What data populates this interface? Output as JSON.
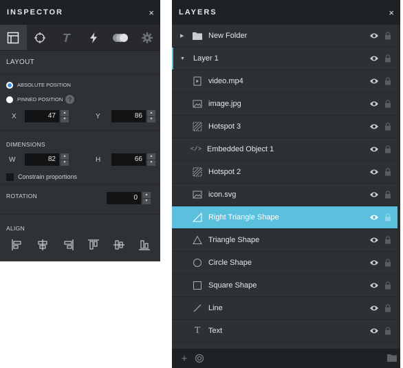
{
  "inspector": {
    "title": "INSPECTOR",
    "close": "×",
    "tabs": [
      {
        "icon": "layout-icon",
        "active": true
      },
      {
        "icon": "crosshair-icon",
        "active": false
      },
      {
        "icon": "text-icon",
        "active": false
      },
      {
        "icon": "lightning-icon",
        "active": false
      },
      {
        "icon": "blend-icon",
        "active": false
      },
      {
        "icon": "gear-icon",
        "active": false
      }
    ],
    "layout": {
      "title": "LAYOUT",
      "absolute_label": "ABSOLUTE POSITION",
      "pinned_label": "PINNED POSITION",
      "help": "?",
      "x_label": "X",
      "x_value": "47",
      "y_label": "Y",
      "y_value": "86"
    },
    "dimensions": {
      "title": "DIMENSIONS",
      "w_label": "W",
      "w_value": "82",
      "h_label": "H",
      "h_value": "66",
      "constrain_label": "Constrain proportions"
    },
    "rotation": {
      "title": "ROTATION",
      "value": "0"
    },
    "align": {
      "title": "ALIGN",
      "buttons": [
        "align-left-icon",
        "align-center-h-icon",
        "align-right-icon",
        "align-top-icon",
        "align-middle-v-icon",
        "align-bottom-icon"
      ]
    }
  },
  "layers": {
    "title": "LAYERS",
    "close": "×",
    "items": [
      {
        "name": "New Folder",
        "icon": "folder-icon",
        "kind": "folder"
      },
      {
        "name": "Layer 1",
        "icon": "",
        "kind": "group"
      },
      {
        "name": "video.mp4",
        "icon": "video-icon",
        "kind": "item"
      },
      {
        "name": "image.jpg",
        "icon": "image-icon",
        "kind": "item"
      },
      {
        "name": "Hotspot 3",
        "icon": "hotspot-icon",
        "kind": "item"
      },
      {
        "name": "Embedded Object 1",
        "icon": "code-icon",
        "kind": "item"
      },
      {
        "name": "Hotspot 2",
        "icon": "hotspot-icon",
        "kind": "item"
      },
      {
        "name": "icon.svg",
        "icon": "image-icon",
        "kind": "item"
      },
      {
        "name": "Right Triangle Shape",
        "icon": "right-triangle-icon",
        "kind": "item",
        "selected": true
      },
      {
        "name": "Triangle Shape",
        "icon": "triangle-icon",
        "kind": "item"
      },
      {
        "name": "Circle Shape",
        "icon": "circle-icon",
        "kind": "item"
      },
      {
        "name": "Square Shape",
        "icon": "square-icon",
        "kind": "item"
      },
      {
        "name": "Line",
        "icon": "line-icon",
        "kind": "item"
      },
      {
        "name": "Text",
        "icon": "text-T-icon",
        "kind": "item"
      }
    ],
    "footer": {
      "add": "+"
    }
  },
  "colors": {
    "accent": "#5bc0de",
    "panel_bg": "#2f3235",
    "header_bg": "#1f2225"
  }
}
